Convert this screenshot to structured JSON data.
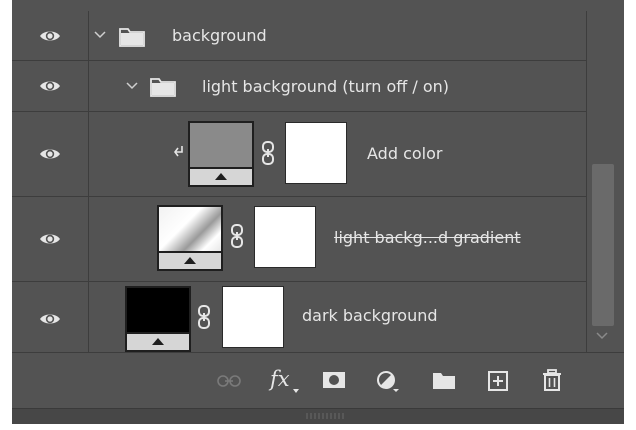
{
  "layers": [
    {
      "name": "background",
      "type": "group",
      "visible": true
    },
    {
      "name": "light background (turn off / on)",
      "type": "group",
      "visible": true
    },
    {
      "name": "Add color",
      "type": "fill",
      "visible": true,
      "clipped": true
    },
    {
      "name": "light backg...d gradient",
      "type": "gradient",
      "visible": true,
      "strikethrough": true
    },
    {
      "name": "dark background",
      "type": "fill",
      "visible": true
    }
  ],
  "toolbar": {
    "icons": [
      "link-layers-icon",
      "fx-icon",
      "add-mask-icon",
      "adjustment-layer-icon",
      "new-group-icon",
      "new-layer-icon",
      "delete-icon"
    ],
    "fx_label": "fx"
  },
  "colors": {
    "panel": "#535353",
    "divider": "#3d3d3d",
    "text": "#e6e6e6",
    "add_color_fill": "#8a8a8a",
    "dark_fill": "#000000"
  }
}
